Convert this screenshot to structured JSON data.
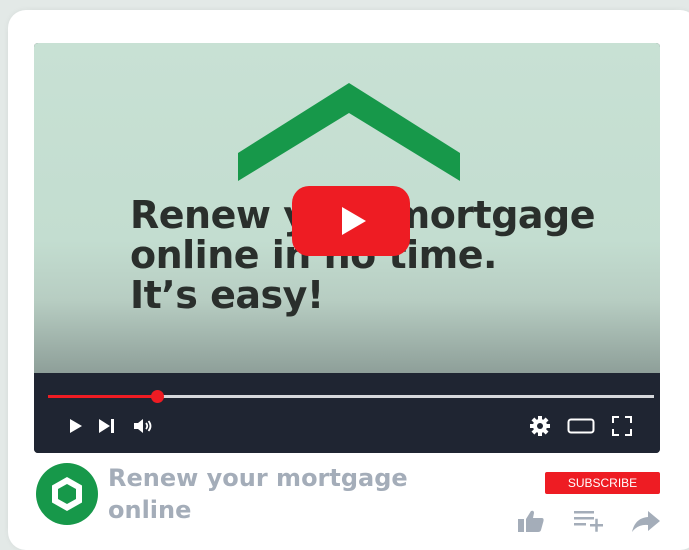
{
  "video": {
    "headline": "Renew your mortgage\nonline in no time.\nIt’s easy!",
    "progress_fraction": 0.18
  },
  "channel": {
    "title": "Renew your mortgage online",
    "subscribe_label": "SUBSCRIBE"
  },
  "icons": {
    "play_overlay": "play-icon",
    "play": "play-icon",
    "next": "skip-next-icon",
    "volume": "volume-icon",
    "settings": "gear-icon",
    "theater": "theater-mode-icon",
    "fullscreen": "fullscreen-icon",
    "like": "thumbs-up-icon",
    "queue": "add-to-queue-icon",
    "share": "share-icon",
    "logo": "hexagon-logo-icon"
  },
  "colors": {
    "accent": "#ee1c23",
    "brand_green": "#17984a",
    "title_gray": "#a4adb9",
    "controls_bg": "#1f2532"
  }
}
